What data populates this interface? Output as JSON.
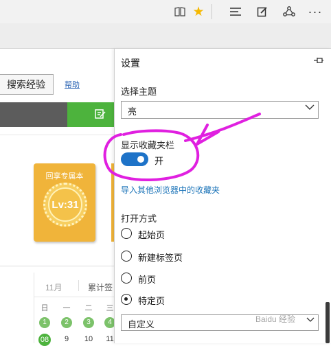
{
  "toolbar": {
    "icons": [
      "reading-view-icon",
      "favorite-star-icon",
      "hub-icon",
      "web-note-icon",
      "share-icon",
      "more-icon"
    ],
    "accent_color": "#f5b800"
  },
  "page": {
    "search_button": "搜索经验",
    "help_link": "帮助",
    "book": {
      "title": "回享专属本",
      "level": "Lv:31"
    },
    "calendar": {
      "month": "11月",
      "cumulative": "累计签",
      "weekdays": [
        "日",
        "一",
        "二",
        "三"
      ],
      "row1": [
        "1",
        "2",
        "3",
        "4"
      ],
      "row2": [
        "08",
        "9",
        "10",
        "11"
      ]
    }
  },
  "settings": {
    "title": "设置",
    "theme_label": "选择主题",
    "theme_value": "亮",
    "favorites_bar_label": "显示收藏夹栏",
    "favorites_bar_state": "开",
    "import_link": "导入其他浏览器中的收藏夹",
    "open_with_label": "打开方式",
    "open_options": [
      "起始页",
      "新建标签页",
      "前页",
      "特定页"
    ],
    "selected_option": "特定页",
    "custom_value": "自定义",
    "toggle_color": "#1e73c8"
  },
  "watermark": "Baidu 经验"
}
